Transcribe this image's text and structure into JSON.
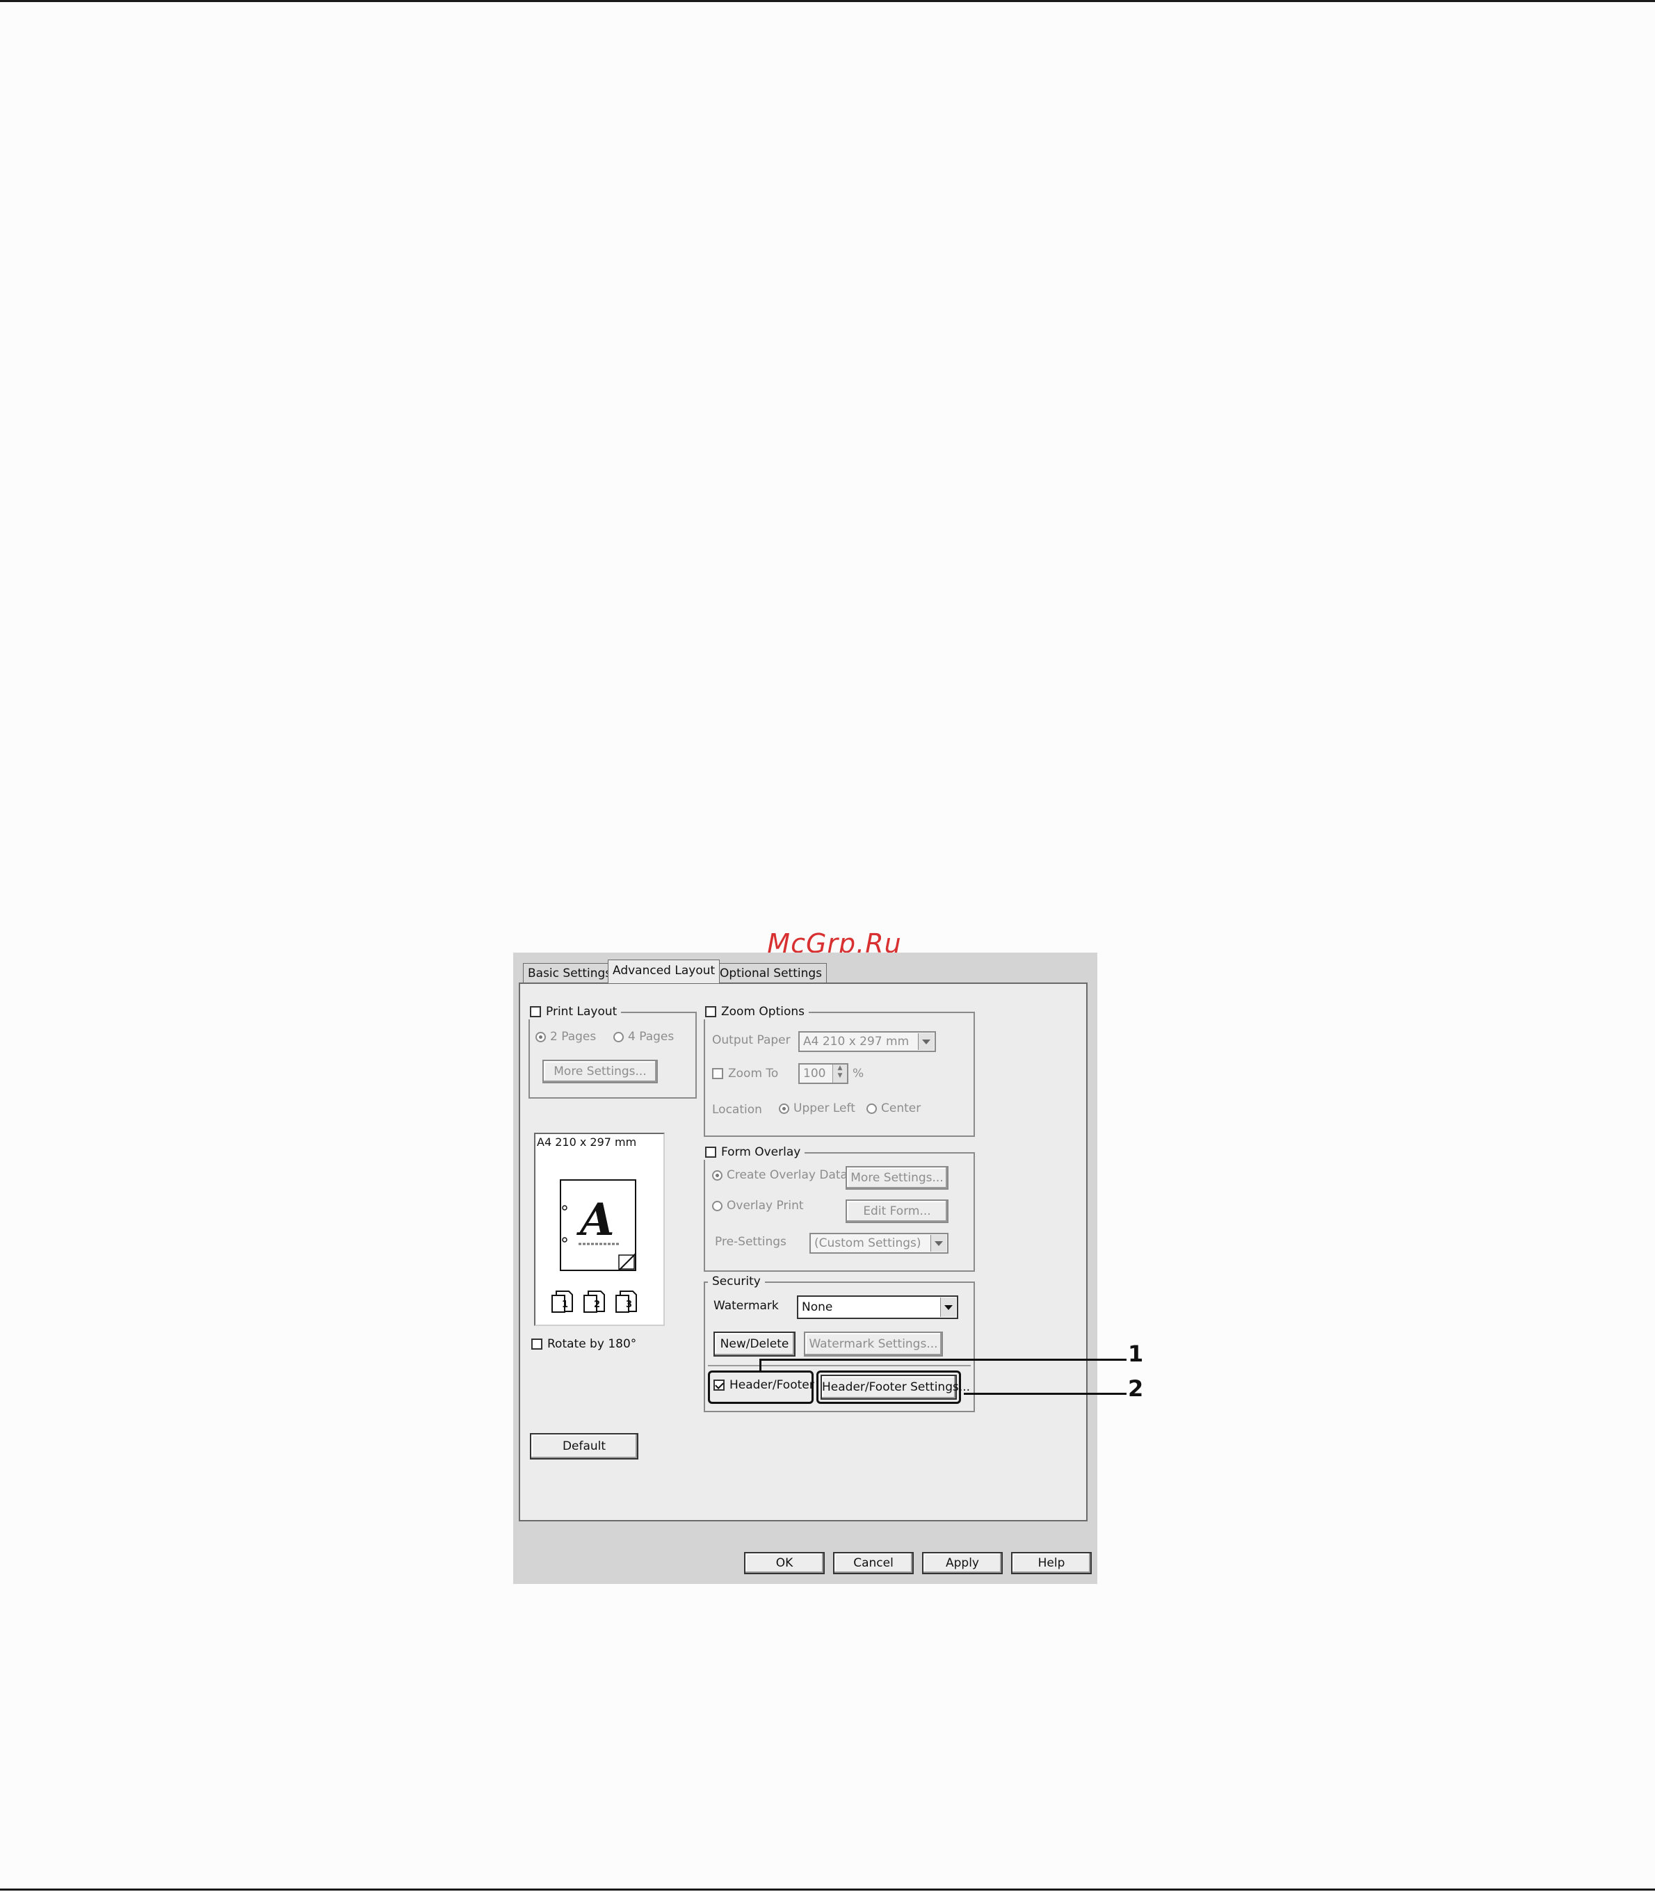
{
  "watermark_text": "McGrp.Ru",
  "tabs": [
    {
      "label": "Basic Settings",
      "active": false
    },
    {
      "label": "Advanced Layout",
      "active": true
    },
    {
      "label": "Optional Settings",
      "active": false
    }
  ],
  "print_layout": {
    "label": "Print Layout",
    "checked": false,
    "options": [
      "2 Pages",
      "4 Pages"
    ],
    "selected": "2 Pages",
    "more_settings_label": "More Settings..."
  },
  "preview": {
    "paper_label": "A4 210 x 297 mm",
    "sample_letter": "A",
    "stack_numbers": [
      "1",
      "2",
      "3"
    ]
  },
  "rotate": {
    "label": "Rotate by 180°",
    "checked": false
  },
  "default_button": "Default",
  "zoom_options": {
    "label": "Zoom Options",
    "checked": false,
    "output_paper_label": "Output Paper",
    "output_paper_value": "A4 210 x 297 mm",
    "zoom_to_label": "Zoom To",
    "zoom_to_value": "100",
    "zoom_unit": "%",
    "location_label": "Location",
    "location_options": [
      "Upper Left",
      "Center"
    ],
    "location_selected": "Upper Left"
  },
  "form_overlay": {
    "label": "Form Overlay",
    "checked": false,
    "create_label": "Create Overlay Data",
    "overlay_print_label": "Overlay Print",
    "more_settings_label": "More Settings...",
    "edit_form_label": "Edit Form...",
    "pre_settings_label": "Pre-Settings",
    "pre_settings_value": "(Custom Settings)"
  },
  "security": {
    "label": "Security",
    "watermark_label": "Watermark",
    "watermark_value": "None",
    "new_delete_label": "New/Delete",
    "watermark_settings_label": "Watermark Settings...",
    "header_footer_label": "Header/Footer",
    "header_footer_checked": true,
    "header_footer_settings_label": "Header/Footer Settings..."
  },
  "footer_buttons": {
    "ok": "OK",
    "cancel": "Cancel",
    "apply": "Apply",
    "help": "Help"
  },
  "callouts": [
    "1",
    "2"
  ]
}
